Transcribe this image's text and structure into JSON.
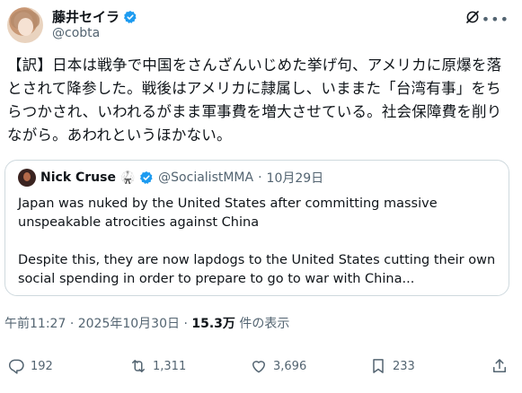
{
  "author": {
    "name": "藤井セイラ",
    "handle": "@cobta"
  },
  "post": {
    "lines": [
      "【訳】日本は戦争で中国をさんざんいじめた挙げ句、アメリカに原爆を落",
      "とされて降参した。戦後はアメリカに隷属し、いままた「台湾有事」をち",
      "らつかされ、いわれるがまま軍事費を増大させている。社会保障費を削り",
      "ながら。あわれというほかない。"
    ]
  },
  "quote": {
    "name": "Nick Cruse",
    "emoji": "🥋",
    "handle": "@SocialistMMA",
    "separator": "·",
    "date": "10月29日",
    "para1": "Japan was nuked by the United States after committing massive unspeakable atrocities against China",
    "para2": "Despite this, they are now lapdogs to the United States cutting their own social spending in order to prepare to go to war with China..."
  },
  "meta": {
    "time": "午前11:27",
    "sep": "·",
    "date": "2025年10月30日",
    "sep2": "·",
    "views": "15.3万",
    "views_label": "件の表示"
  },
  "actions": {
    "replies": "192",
    "reposts": "1,311",
    "likes": "3,696",
    "bookmarks": "233"
  },
  "colors": {
    "verified": "#1d9bf0",
    "secondary": "#536471",
    "border": "#cfd9de"
  },
  "icons": [
    "verified-badge-icon",
    "grok-icon",
    "more-icon",
    "reply-icon",
    "repost-icon",
    "like-icon",
    "bookmark-icon",
    "share-icon"
  ]
}
